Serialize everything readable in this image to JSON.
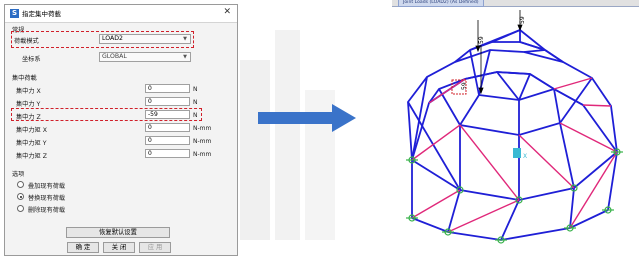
{
  "dialog": {
    "title": "指定集中荷載",
    "app_icon": "S",
    "close_glyph": "✕",
    "general": {
      "section_label": "常规",
      "load_pattern_label": "荷載模式",
      "load_pattern_value": "LOAD2",
      "coord_label": "坐标系",
      "coord_value": "GLOBAL"
    },
    "concentrated": {
      "section_label": "集中荷載",
      "fields": [
        {
          "label": "集中力 X",
          "value": "0",
          "unit": "N"
        },
        {
          "label": "集中力 Y",
          "value": "0",
          "unit": "N"
        },
        {
          "label": "集中力 Z",
          "value": "-59",
          "unit": "N"
        },
        {
          "label": "集中力矩 X",
          "value": "0",
          "unit": "N-mm"
        },
        {
          "label": "集中力矩 Y",
          "value": "0",
          "unit": "N-mm"
        },
        {
          "label": "集中力矩 Z",
          "value": "0",
          "unit": "N-mm"
        }
      ]
    },
    "options": {
      "section_label": "选项",
      "items": [
        {
          "label": "叠加现有荷载",
          "selected": false
        },
        {
          "label": "替换现有荷载",
          "selected": true
        },
        {
          "label": "删除现有荷载",
          "selected": false
        }
      ]
    },
    "buttons": {
      "reset": "恢复默认设置",
      "ok": "确 定",
      "close": "关 闭",
      "apply": "应 用"
    }
  },
  "viewport": {
    "tab_label": "Joint Loads (LOAD2) (As Defined)",
    "load_value_label": "59",
    "axis_label": "X",
    "colors": {
      "frame_blue": "#1f1fd6",
      "frame_pink": "#e0287a",
      "support_green": "#38b24a",
      "highlight_red": "#d0202a",
      "arrow_blue": "#3a73c9"
    }
  }
}
